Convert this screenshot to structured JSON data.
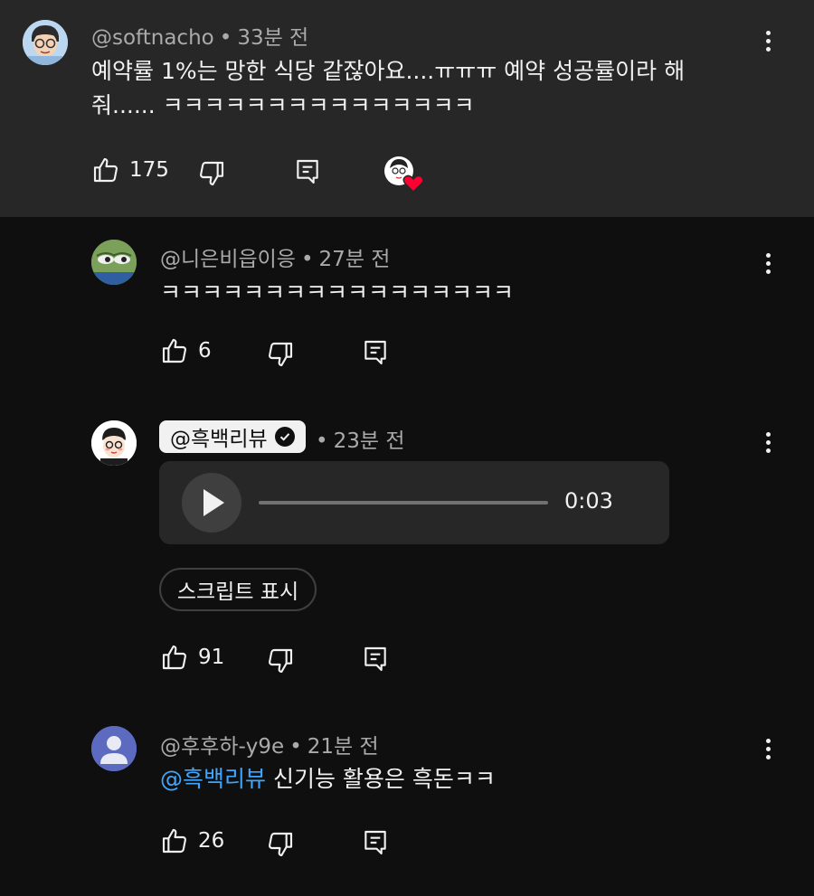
{
  "comments": [
    {
      "author": "@softnacho",
      "time": "33분 전",
      "text": "예약률 1%는 망한 식당 같잖아요....ㅠㅠㅠ 예약 성공률이라 해 줘...... ㅋㅋㅋㅋㅋㅋㅋㅋㅋㅋㅋㅋㅋㅋㅋ",
      "likes": "175"
    },
    {
      "author": "@니은비읍이응",
      "time": "27분 전",
      "text": "ㅋㅋㅋㅋㅋㅋㅋㅋㅋㅋㅋㅋㅋㅋㅋㅋㅋ",
      "likes": "6"
    },
    {
      "author": "@흑백리뷰",
      "time": "23분 전",
      "audio_duration": "0:03",
      "audio_progress": 0.0,
      "show_script_label": "스크립트 표시",
      "likes": "91"
    },
    {
      "author": "@후후하-y9e",
      "time": "21분 전",
      "mention": "@흑백리뷰",
      "text": "신기능 활용은 흑돈ㅋㅋ",
      "likes": "26"
    }
  ],
  "separator": "•",
  "icons": {
    "like": "thumbs-up-icon",
    "dislike": "thumbs-down-icon",
    "reply": "reply-icon",
    "more": "more-vert-icon",
    "heart": "creator-heart-icon",
    "play": "play-icon",
    "verified": "verified-check-icon"
  },
  "colors": {
    "background": "#0f0f0f",
    "highlight_background": "#272727",
    "text": "#f1f1f1",
    "secondary_text": "#aaaaaa",
    "mention": "#3ea6ff",
    "heart": "#ff0033",
    "default_avatar": "#5c6bc0"
  }
}
